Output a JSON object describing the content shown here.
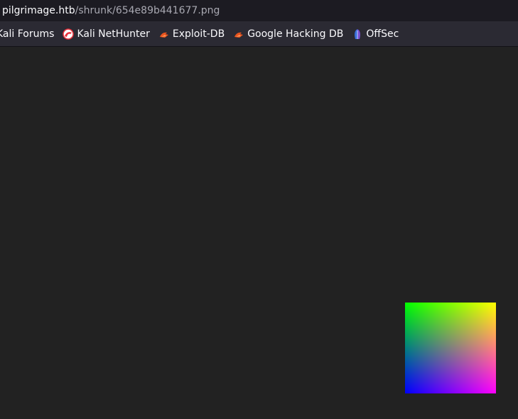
{
  "url": {
    "host": "pilgrimage.htb",
    "path": "/shrunk/654e89b441677.png"
  },
  "bookmarks": [
    {
      "label": "Kali Forums",
      "icon": "kali-forums-icon"
    },
    {
      "label": "Kali NetHunter",
      "icon": "kali-nethunter-icon"
    },
    {
      "label": "Exploit-DB",
      "icon": "exploit-db-icon"
    },
    {
      "label": "Google Hacking DB",
      "icon": "google-hacking-db-icon"
    },
    {
      "label": "OffSec",
      "icon": "offsec-icon"
    }
  ],
  "colors": {
    "toolbar_bg": "#1c1b22",
    "bookmarks_bg": "#2b2a33",
    "content_bg": "#222222",
    "exploit_icon": "#e8541f"
  }
}
